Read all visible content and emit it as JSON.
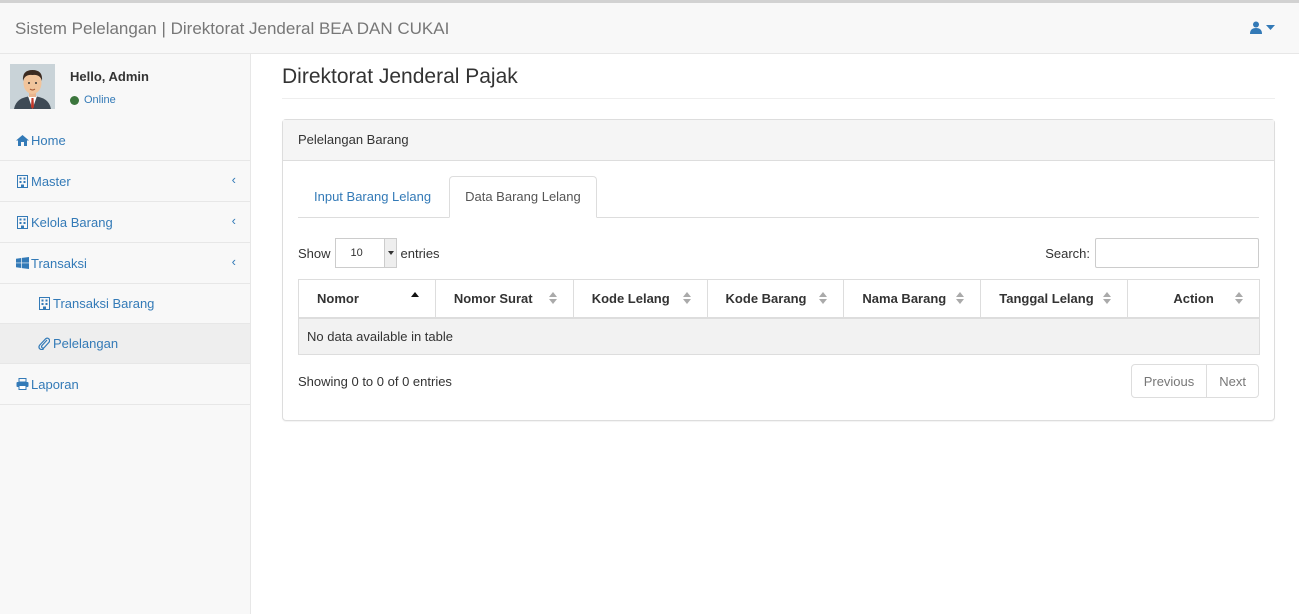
{
  "app": {
    "brand": "Sistem Pelelangan | Direktorat Jenderal BEA DAN CUKAI"
  },
  "user_menu": {
    "icon": "user-icon"
  },
  "user_panel": {
    "greeting": "Hello, Admin",
    "status": "Online",
    "status_color": "#3c763d"
  },
  "sidebar": {
    "items": [
      {
        "label": "Home",
        "icon": "home-icon"
      },
      {
        "label": "Master",
        "icon": "building-icon",
        "has_children": true
      },
      {
        "label": "Kelola Barang",
        "icon": "building-icon",
        "has_children": true
      },
      {
        "label": "Transaksi",
        "icon": "windows-icon",
        "has_children": true
      },
      {
        "label": "Transaksi Barang",
        "icon": "building-icon",
        "sub": true
      },
      {
        "label": "Pelelangan",
        "icon": "paperclip-icon",
        "sub": true,
        "active": true
      },
      {
        "label": "Laporan",
        "icon": "print-icon"
      }
    ]
  },
  "main": {
    "title": "Direktorat Jenderal Pajak"
  },
  "panel": {
    "heading": "Pelelangan Barang",
    "tabs": [
      {
        "label": "Input Barang Lelang",
        "active": false
      },
      {
        "label": "Data Barang Lelang",
        "active": true
      }
    ],
    "length": {
      "show": "Show",
      "value": "10",
      "entries": "entries"
    },
    "search": {
      "label": "Search:",
      "value": ""
    },
    "table": {
      "columns": [
        "Nomor",
        "Nomor Surat",
        "Kode Lelang",
        "Kode Barang",
        "Nama Barang",
        "Tanggal Lelang",
        "Action"
      ],
      "empty": "No data available in table"
    },
    "info": "Showing 0 to 0 of 0 entries",
    "pager": {
      "previous": "Previous",
      "next": "Next"
    }
  },
  "colors": {
    "link": "#337ab7",
    "sidebar_bg": "#f8f8f8",
    "active_bg": "#eeeeee"
  }
}
